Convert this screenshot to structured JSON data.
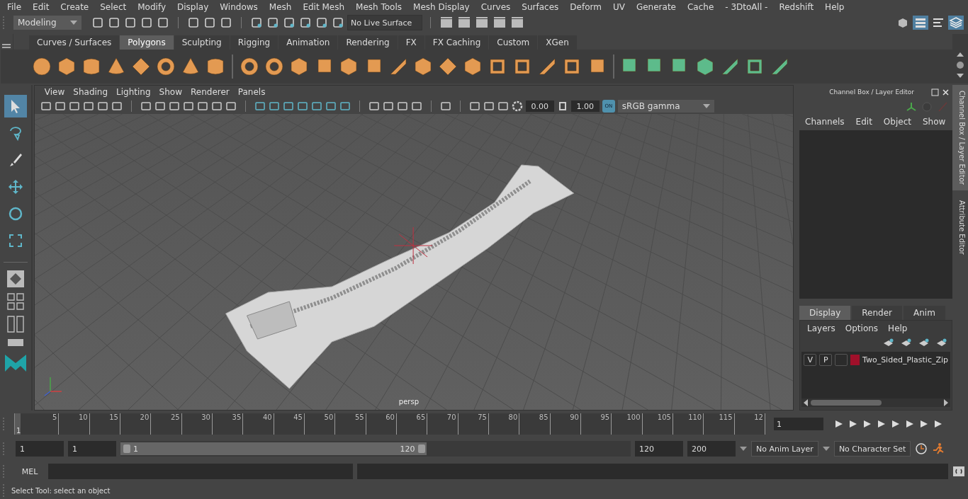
{
  "menu_bar": [
    "File",
    "Edit",
    "Create",
    "Select",
    "Modify",
    "Display",
    "Windows",
    "Mesh",
    "Edit Mesh",
    "Mesh Tools",
    "Mesh Display",
    "Curves",
    "Surfaces",
    "Deform",
    "UV",
    "Generate",
    "Cache",
    "- 3DtoAll -",
    "Redshift",
    "Help"
  ],
  "status_line": {
    "workspace": "Modeling",
    "live_surface": "No Live Surface"
  },
  "shelf_tabs": [
    {
      "label": "Curves / Surfaces",
      "selected": false
    },
    {
      "label": "Polygons",
      "selected": true
    },
    {
      "label": "Sculpting",
      "selected": false
    },
    {
      "label": "Rigging",
      "selected": false
    },
    {
      "label": "Animation",
      "selected": false
    },
    {
      "label": "Rendering",
      "selected": false
    },
    {
      "label": "FX",
      "selected": false
    },
    {
      "label": "FX Caching",
      "selected": false
    },
    {
      "label": "Custom",
      "selected": false
    },
    {
      "label": "XGen",
      "selected": false
    }
  ],
  "tool_box": [
    {
      "kind": "select",
      "selected": true
    },
    {
      "kind": "lasso",
      "selected": false
    },
    {
      "kind": "paint",
      "selected": false
    },
    {
      "kind": "move",
      "selected": false
    },
    {
      "kind": "rotate",
      "selected": false
    },
    {
      "kind": "scale",
      "selected": false
    }
  ],
  "viewport": {
    "menu": [
      "View",
      "Shading",
      "Lighting",
      "Show",
      "Renderer",
      "Panels"
    ],
    "exposure": "0.00",
    "gamma": "1.00",
    "color_management": "ON",
    "color_space": "sRGB gamma",
    "camera": "persp"
  },
  "channel_box": {
    "title": "Channel Box / Layer Editor",
    "menu": [
      "Channels",
      "Edit",
      "Object",
      "Show"
    ]
  },
  "layer_editor": {
    "tabs": [
      {
        "label": "Display",
        "selected": true
      },
      {
        "label": "Render",
        "selected": false
      },
      {
        "label": "Anim",
        "selected": false
      }
    ],
    "menu": [
      "Layers",
      "Options",
      "Help"
    ],
    "layers": [
      {
        "visible": "V",
        "playback": "P",
        "color": "#a0102a",
        "name": "Two_Sided_Plastic_Zip"
      }
    ]
  },
  "side_tabs": [
    {
      "label": "Channel Box / Layer Editor",
      "selected": true
    },
    {
      "label": "Attribute Editor",
      "selected": false
    }
  ],
  "time_slider": {
    "start": "1",
    "ticks": [
      "5",
      "10",
      "15",
      "20",
      "25",
      "30",
      "35",
      "40",
      "45",
      "50",
      "55",
      "60",
      "65",
      "70",
      "75",
      "80",
      "85",
      "90",
      "95",
      "100",
      "105",
      "110",
      "115",
      "12"
    ],
    "current_frame": "1",
    "level": 0
  },
  "range_slider": {
    "start": "1",
    "playback_start": "1",
    "range_start": "1",
    "range_end": "120",
    "playback_end": "120",
    "end": "200",
    "anim_layer": "No Anim Layer",
    "character_set": "No Character Set",
    "level": 0.6
  },
  "command_line": {
    "label": "MEL"
  },
  "help_line": "Select Tool: select an object"
}
